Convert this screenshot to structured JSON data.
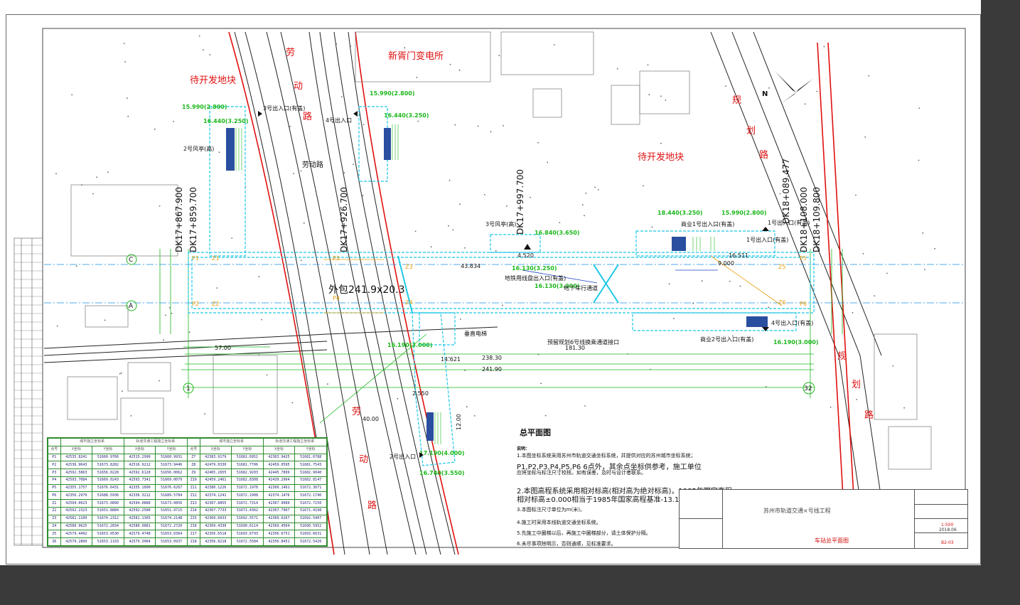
{
  "drawing": {
    "title": "总平面图",
    "notes_label": "说明：",
    "notes": [
      "1.本图坐标系统采用苏州市轨道交通坐标系统，并提供对应的苏州城市坐标系统；",
      "P1,P2,P3,P4,P5,P6 6点外，其余点坐标供参考，施工单位",
      "应将坐标与标注尺寸校核。如有误差，及时与设计者联系。",
      "2.本图高程系统采用相对标高(相对高为绝对标高)，1985年国家高程",
      "相对标高±0.000相当于1985年国家高程基准-13.190;",
      "3.本图标注尺寸单位为m(米)。",
      "4.施工时采用本线轨道交通坐标系统。",
      "5.先施工中圈梯以后，再施工中圈梯部分，请土体保护分隔。",
      "6.未尽事项除明示，否则通顺，见标准要求。"
    ],
    "project": "苏州市轨道交通×号线工程",
    "drawing_name": "车站总平面图",
    "scale": "1:500",
    "date": "2018.06",
    "sheet_no": "B2-03"
  },
  "labels": {
    "road1": [
      "劳",
      "动",
      "路"
    ],
    "road2": [
      "劳",
      "动",
      "路"
    ],
    "road_planning1": [
      "规",
      "划",
      "路"
    ],
    "road_planning2": [
      "规",
      "划",
      "路"
    ],
    "plot_west": "待开发地块",
    "plot_east": "待开发地块",
    "substation": "新胥门变电所",
    "road_center": "劳动路",
    "station_len": "外包241.9x20.3",
    "chainage": [
      "DK17+867.900",
      "DK17+859.700",
      "DK17+926.700",
      "DK17+997.700",
      "DK18+089.477",
      "DK18+108.000",
      "DK18+109.800"
    ],
    "dims": [
      "238.30",
      "241.90",
      "181.30",
      "57.00",
      "14.621",
      "40.00",
      "43.834",
      "9.000",
      "16.511",
      "4.520",
      "2.550",
      "12.00"
    ],
    "elev": [
      "15.990(2.800)",
      "16.440(3.250)",
      "15.990(2.800)",
      "16.130(3.250)",
      "18.440(3.250)",
      "15.990(2.800)",
      "16.840(3.650)",
      "16.130(3.000)",
      "16.190(3.000)",
      "17.190(4.000)",
      "16.740(3.550)",
      "16.440(3.250)",
      "16.190(3.000)"
    ],
    "exits": [
      "3号出入口(有盖)",
      "4号出入口",
      "1号出入口(有盖)",
      "2号出入口",
      "商业1号出入口(有盖)",
      "商业2号出入口(有盖)",
      "3号风亭(高)",
      "2号风亭(高)",
      "地铁用线盘出入口(有盖)",
      "地下车行通道",
      "预留规划6号线换乘通道接口",
      "垂直电梯",
      "4号出入口(有盖)",
      "1号出入口(有盖)"
    ],
    "axis": [
      "C",
      "A",
      "1",
      "32"
    ],
    "pts": [
      "P1",
      "P2",
      "P3",
      "P4",
      "P5",
      "P6",
      "Z1",
      "Z2",
      "Z3",
      "Z4",
      "Z5",
      "Z6"
    ]
  },
  "coord_table": {
    "headers": [
      "点号",
      "X坐标",
      "Y坐标",
      "X坐标",
      "Y坐标",
      "点号",
      "X坐标",
      "Y坐标",
      "X坐标",
      "Y坐标"
    ],
    "group_headers": [
      "城市独立坐标系",
      "轨道交通工程独立坐标系",
      "城市独立坐标系",
      "轨道交通工程独立坐标系"
    ],
    "rows": [
      [
        "P1",
        "42535.8241",
        "51660.9766",
        "42515.2990",
        "51660.9931",
        "Z7",
        "42383.9179",
        "51681.6951",
        "42363.9425",
        "51681.6788"
      ],
      [
        "P2",
        "42536.9643",
        "51673.8282",
        "42516.9212",
        "51673.9446",
        "Z8",
        "42479.0330",
        "51681.7706",
        "42459.0595",
        "51681.7543"
      ],
      [
        "P3",
        "42592.5863",
        "51656.0228",
        "42592.6120",
        "51656.0062",
        "Z9",
        "42465.2655",
        "51682.9203",
        "42445.7899",
        "51682.9040"
      ],
      [
        "P4",
        "42593.7084",
        "51669.0243",
        "42593.7341",
        "51669.0079",
        "Z10",
        "42459.2461",
        "51682.8308",
        "42439.2964",
        "51682.8147"
      ],
      [
        "P5",
        "42355.1757",
        "51676.6431",
        "42335.1090",
        "51676.6267",
        "Z11",
        "42380.1226",
        "51672.1978",
        "42360.1461",
        "51672.3071"
      ],
      [
        "P6",
        "42356.2979",
        "51688.5936",
        "42336.3212",
        "51689.5784",
        "Z12",
        "42374.1241",
        "51672.1908",
        "42374.1476",
        "51672.1746"
      ],
      [
        "Z1",
        "42594.0023",
        "51673.0890",
        "42594.0880",
        "51673.0856",
        "Z13",
        "42367.8855",
        "51672.7314",
        "42367.9089",
        "51672.7150"
      ],
      [
        "Z2",
        "42592.2323",
        "51651.8884",
        "42592.2580",
        "51651.9715",
        "Z14",
        "42367.7733",
        "51671.4362",
        "42367.7967",
        "51671.4198"
      ],
      [
        "Z3",
        "42581.1109",
        "51674.2312",
        "42581.1365",
        "51674.2148",
        "Z15",
        "42369.6033",
        "51692.5571",
        "42369.6267",
        "51692.5407"
      ],
      [
        "Z4",
        "42580.9625",
        "51672.2834",
        "42580.9881",
        "51672.2720",
        "Z16",
        "42369.4330",
        "51690.6114",
        "42369.4564",
        "51690.5952"
      ],
      [
        "Z5",
        "42579.4492",
        "51653.0530",
        "42579.4748",
        "51653.0364",
        "Z17",
        "42356.6518",
        "51693.6793",
        "42356.6751",
        "51693.6631"
      ],
      [
        "Z6",
        "42579.2809",
        "51653.1103",
        "42579.3064",
        "51653.0937",
        "Z18",
        "42356.8218",
        "51672.5584",
        "42356.8451",
        "51672.5420"
      ]
    ]
  },
  "colors": {
    "station": "#1fc8e8",
    "green": "#1db81d",
    "red": "#e01010",
    "road": "#222222",
    "blue": "#1a40c8",
    "orange": "#e8a010",
    "magenta": "#c010c0"
  }
}
